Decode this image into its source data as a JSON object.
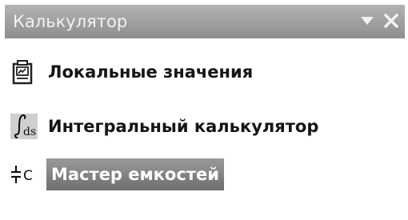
{
  "panel": {
    "title": "Калькулятор"
  },
  "items": [
    {
      "label": "Локальные значения",
      "icon": "local-values-icon"
    },
    {
      "label": "Интегральный калькулятор",
      "icon": "integral-icon"
    },
    {
      "label": "Мастер емкостей",
      "icon": "capacitance-icon",
      "selected": true
    }
  ],
  "colors": {
    "titlebar": "#9f9f9f",
    "selection": "#7d7d7d",
    "text": "#151515"
  }
}
